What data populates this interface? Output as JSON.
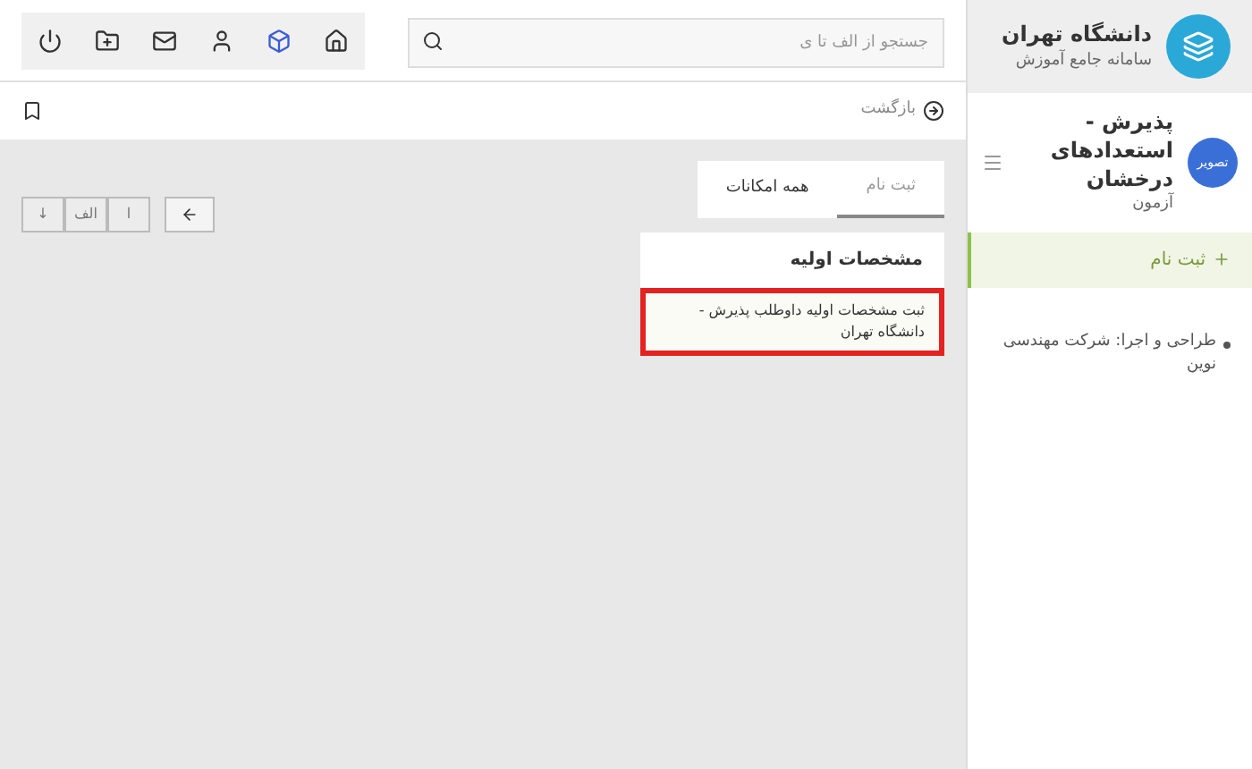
{
  "sidebar": {
    "university": "دانشگاه تهران",
    "system": "سامانه جامع آموزش",
    "user_badge": "تصویر",
    "service": "پذیرش - استعدادهای درخشان",
    "service_sub": "آزمون",
    "items": [
      {
        "label": "ثبت نام",
        "selected": true
      }
    ],
    "footer": "طراحی و اجرا: شرکت مهندسی نوین"
  },
  "toolbar": {
    "search": {
      "placeholder": "جستجو از الف تا ی"
    }
  },
  "breadcrumb": "بازگشت",
  "pager": [
    "ا",
    "الف",
    "↓"
  ],
  "tabs": [
    {
      "label": "ثبت نام",
      "selected": true
    },
    {
      "label": "همه امکانات",
      "selected": false
    }
  ],
  "panel": {
    "title": "مشخصات اولیه",
    "rows": [
      {
        "text": "ثبت مشخصات اولیه داوطلب پذیرش - دانشگاه تهران",
        "highlighted": true
      }
    ]
  }
}
